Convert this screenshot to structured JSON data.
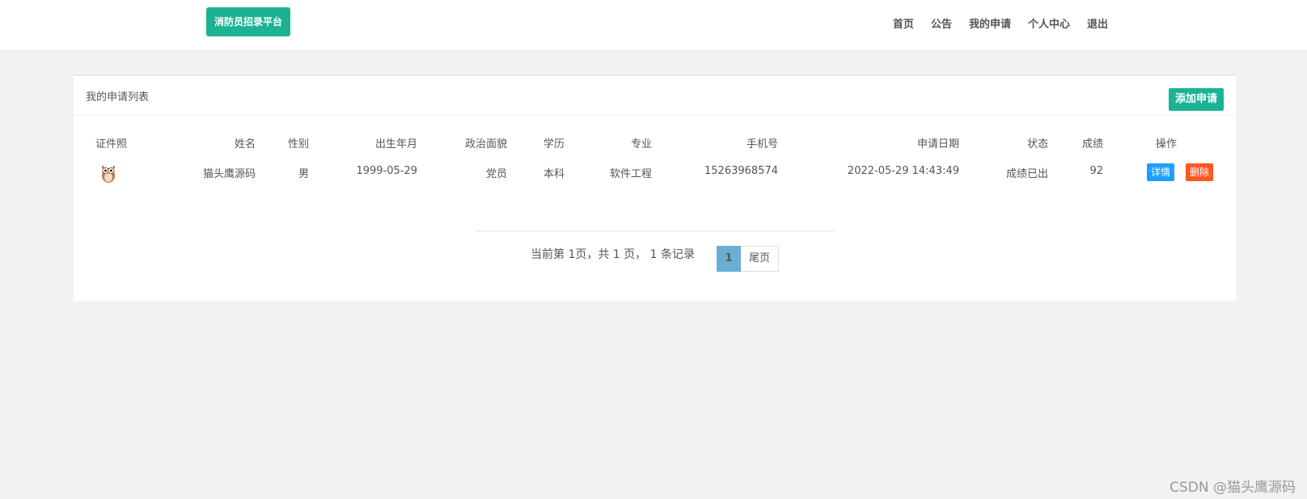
{
  "header": {
    "brand": "消防员招录平台",
    "nav": [
      "首页",
      "公告",
      "我的申请",
      "个人中心",
      "退出"
    ]
  },
  "panel": {
    "title": "我的申请列表",
    "add_button": "添加申请"
  },
  "table": {
    "columns": [
      "证件照",
      "姓名",
      "性别",
      "出生年月",
      "政治面貌",
      "学历",
      "专业",
      "手机号",
      "申请日期",
      "状态",
      "成绩",
      "操作"
    ],
    "rows": [
      {
        "photo_icon": "owl-avatar-icon",
        "name": "猫头鹰源码",
        "gender": "男",
        "birth": "1999-05-29",
        "political": "党员",
        "education": "本科",
        "major": "软件工程",
        "phone": "15263968574",
        "apply_date": "2022-05-29 14:43:49",
        "status": "成绩已出",
        "score": "92",
        "detail_label": "详情",
        "delete_label": "删除"
      }
    ]
  },
  "pagination": {
    "info": "当前第 1页，共 1 页， 1 条记录",
    "current": "1",
    "last_label": "尾页"
  },
  "watermark": "CSDN @猫头鹰源码",
  "colors": {
    "accent": "#1bb394",
    "detail": "#1e9fff",
    "delete": "#ff5722",
    "page_current": "#6aaed6"
  }
}
